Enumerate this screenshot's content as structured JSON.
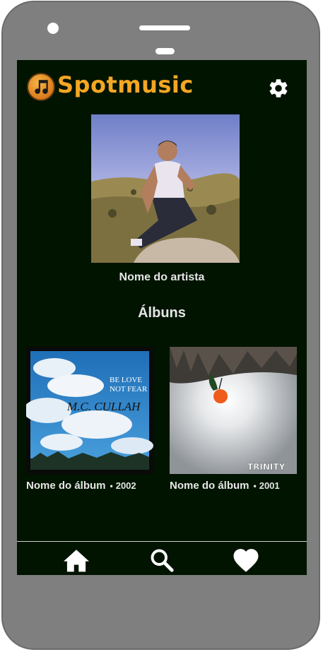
{
  "app": {
    "title": "Spotmusic",
    "brand_color": "#f5a623",
    "background_color": "#001400",
    "logo_icon": "music-note-icon"
  },
  "header": {
    "settings_icon": "gear-icon"
  },
  "artist": {
    "name": "Nome do artista"
  },
  "albums_section": {
    "heading": "Álbuns",
    "albums": [
      {
        "title": "Nome do álbum",
        "separator": "•",
        "year": "2002",
        "cover_text_1": "BE LOVE",
        "cover_text_2": "NOT FEAR",
        "cover_text_3": "M.C. CULLAH"
      },
      {
        "title": "Nome do álbum",
        "separator": "•",
        "year": "2001",
        "cover_text_1": "TRINITY"
      }
    ]
  },
  "bottom_nav": {
    "items": [
      {
        "name": "home",
        "icon": "home-icon"
      },
      {
        "name": "search",
        "icon": "search-icon"
      },
      {
        "name": "favorites",
        "icon": "heart-icon"
      }
    ]
  }
}
